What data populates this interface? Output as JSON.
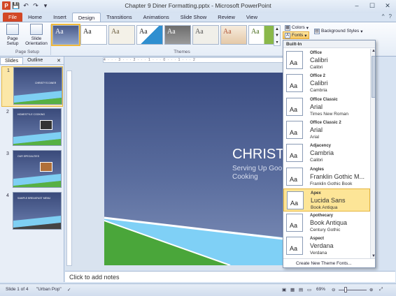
{
  "window": {
    "title": "Chapter 9 Diner Formatting.pptx - Microsoft PowerPoint",
    "app_icon": "P",
    "minimize": "–",
    "maximize": "☐",
    "close": "✕"
  },
  "qat": {
    "save": "💾",
    "undo": "↶",
    "redo": "↷",
    "customize": "▾"
  },
  "ribbon_tabs": [
    "File",
    "Home",
    "Insert",
    "Design",
    "Transitions",
    "Animations",
    "Slide Show",
    "Review",
    "View"
  ],
  "active_tab": "Design",
  "ribbon": {
    "page_setup_label": "Page Setup",
    "slide_orientation_label": "Slide Orientation",
    "page_setup_group": "Page Setup",
    "themes_group": "Themes",
    "theme_sample": "Aa",
    "colors_label": "Colors",
    "fonts_label": "Fonts",
    "background_styles_label": "Background Styles",
    "help_icons": {
      "collapse": "^",
      "help": "?"
    }
  },
  "left_pane": {
    "tabs": [
      "Slides",
      "Outline"
    ],
    "close": "✕",
    "slides": [
      {
        "num": "1",
        "title": "CHRISTY'S DINER"
      },
      {
        "num": "2",
        "title": "HOMESTYLE COOKING"
      },
      {
        "num": "3",
        "title": "OUR SPECIALTIES"
      },
      {
        "num": "4",
        "title": "SAMPLE BREAKFAST MENU"
      }
    ]
  },
  "slide": {
    "title": "CHRISTY",
    "subtitle_line1": "Serving Up Goo",
    "subtitle_line2": "Cooking"
  },
  "ruler_h": "4 · · · 3 · · · 2 · · · 1 · · · 0 · · · 1 · · · 2",
  "notes_placeholder": "Click to add notes",
  "status": {
    "slide_count": "Slide 1 of 4",
    "theme": "\"Urban Pop\"",
    "zoom": "69%",
    "zoom_out": "⊖",
    "zoom_in": "⊕"
  },
  "fonts_dropdown": {
    "section": "Built-In",
    "sample": "Aa",
    "items": [
      {
        "name": "Office",
        "heading": "Calibri",
        "body": "Calibri"
      },
      {
        "name": "Office 2",
        "heading": "Calibri",
        "body": "Cambria"
      },
      {
        "name": "Office Classic",
        "heading": "Arial",
        "body": "Times New Roman"
      },
      {
        "name": "Office Classic 2",
        "heading": "Arial",
        "body": "Arial"
      },
      {
        "name": "Adjacency",
        "heading": "Cambria",
        "body": "Calibri"
      },
      {
        "name": "Angles",
        "heading": "Franklin Gothic M...",
        "body": "Franklin Gothic Book"
      },
      {
        "name": "Apex",
        "heading": "Lucida Sans",
        "body": "Book Antiqua"
      },
      {
        "name": "Apothecary",
        "heading": "Book Antiqua",
        "body": "Century Gothic"
      },
      {
        "name": "Aspect",
        "heading": "Verdana",
        "body": "Verdana"
      }
    ],
    "highlighted": "Apex",
    "footer": "Create New Theme Fonts..."
  }
}
